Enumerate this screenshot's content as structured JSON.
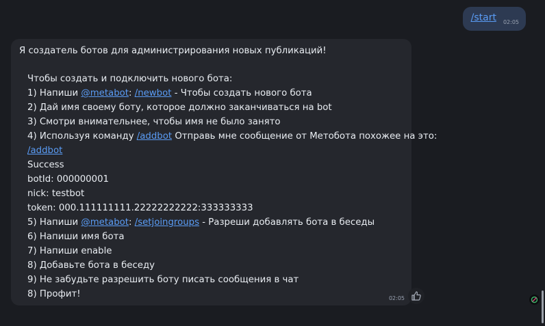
{
  "outgoing": {
    "text": "/start",
    "time": "02:05"
  },
  "incoming": {
    "time": "02:05",
    "lines": {
      "l1": "Я создатель ботов для администрирования новых публикаций!",
      "l2": "Чтобы создать и подключить нового бота:",
      "l3_a": "1) Напиши ",
      "l3_link1": "@metabot",
      "l3_b": ": ",
      "l3_link2": "/newbot",
      "l3_c": " - Чтобы создать нового бота",
      "l4": "2) Дай имя своему боту, которое должно заканчиваться на bot",
      "l5": "3) Смотри внимательнее, чтобы имя не было занято",
      "l6_a": "4) Используя команду ",
      "l6_link": "/addbot",
      "l6_b": " Отправь мне сообщение от Метобота похожее на это:",
      "l7_link": "/addbot",
      "l8": "Success",
      "l9": "botId: 000000001",
      "l10": "nick: testbot",
      "l11": "token: 000.111111111.22222222222:333333333",
      "l12_a": "5) Напиши ",
      "l12_link1": "@metabot",
      "l12_b": ": ",
      "l12_link2": "/setjoingroups",
      "l12_c": " - Разреши добавлять бота в беседы",
      "l13": "6) Напиши имя бота",
      "l14": "7) Напиши enable",
      "l15": "8) Добавьте бота в беседу",
      "l16": "9) Не забудьте разрешить боту писать сообщения в чат",
      "l17": "8) Профит!"
    }
  },
  "colors": {
    "background": "#1a1c21",
    "incoming_bubble": "#25272d",
    "outgoing_bubble": "#2d3a52",
    "link": "#5a9cf5"
  },
  "icons": {
    "like": "thumbs-up-icon",
    "badge": "app-badge-icon"
  }
}
